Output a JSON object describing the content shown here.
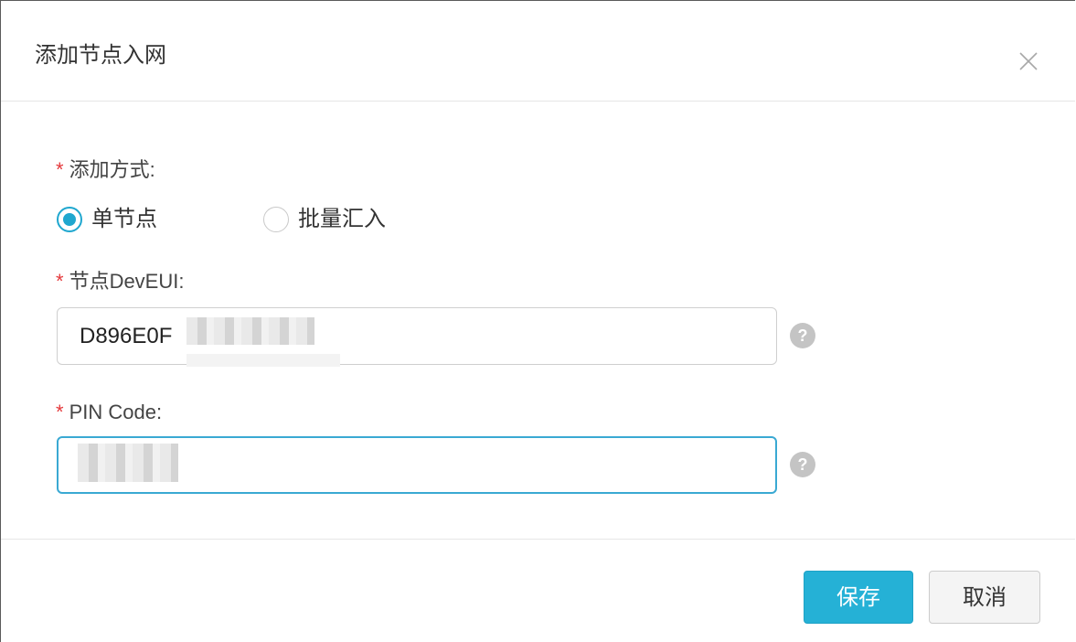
{
  "dialog": {
    "title": "添加节点入网",
    "close_icon": "close-icon"
  },
  "form": {
    "method": {
      "required_mark": "*",
      "label": "添加方式:",
      "options": [
        {
          "label": "单节点",
          "checked": true
        },
        {
          "label": "批量汇入",
          "checked": false
        }
      ]
    },
    "deveui": {
      "required_mark": "*",
      "label": "节点DevEUI:",
      "value": "D896E0F",
      "help_icon": "question-icon",
      "help_text": "?"
    },
    "pin": {
      "required_mark": "*",
      "label": "PIN Code:",
      "value": "",
      "help_icon": "question-icon",
      "help_text": "?"
    }
  },
  "footer": {
    "save_label": "保存",
    "cancel_label": "取消"
  },
  "colors": {
    "accent": "#25b1d6",
    "required": "#e4393c",
    "focus_border": "#3aa9d3"
  }
}
